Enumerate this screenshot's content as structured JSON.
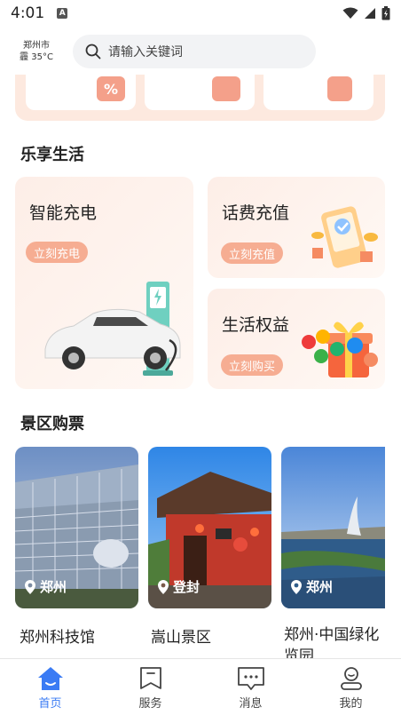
{
  "status_bar": {
    "time": "4:01",
    "a_badge": "A"
  },
  "header": {
    "city": "郑州市",
    "weather": "霾 35°C",
    "search_placeholder": "请输入关键词"
  },
  "section_life": {
    "title": "乐享生活",
    "cards": [
      {
        "title": "智能充电",
        "button": "立刻充电"
      },
      {
        "title": "话费充值",
        "button": "立刻充值"
      },
      {
        "title": "生活权益",
        "button": "立刻购买"
      }
    ]
  },
  "section_scenic": {
    "title": "景区购票",
    "items": [
      {
        "city": "郑州",
        "name": "郑州科技馆"
      },
      {
        "city": "登封",
        "name": "嵩山景区"
      },
      {
        "city": "郑州",
        "name": "郑州·中国绿化",
        "name_line2": "览园"
      }
    ]
  },
  "nav": [
    {
      "label": "首页",
      "icon": "home-icon",
      "active": true
    },
    {
      "label": "服务",
      "icon": "service-icon",
      "active": false
    },
    {
      "label": "消息",
      "icon": "message-icon",
      "active": false
    },
    {
      "label": "我的",
      "icon": "profile-icon",
      "active": false
    }
  ],
  "colors": {
    "accent": "#3a7bf4",
    "pill": "#f6ad92",
    "card_bg": "#fdeee7"
  }
}
